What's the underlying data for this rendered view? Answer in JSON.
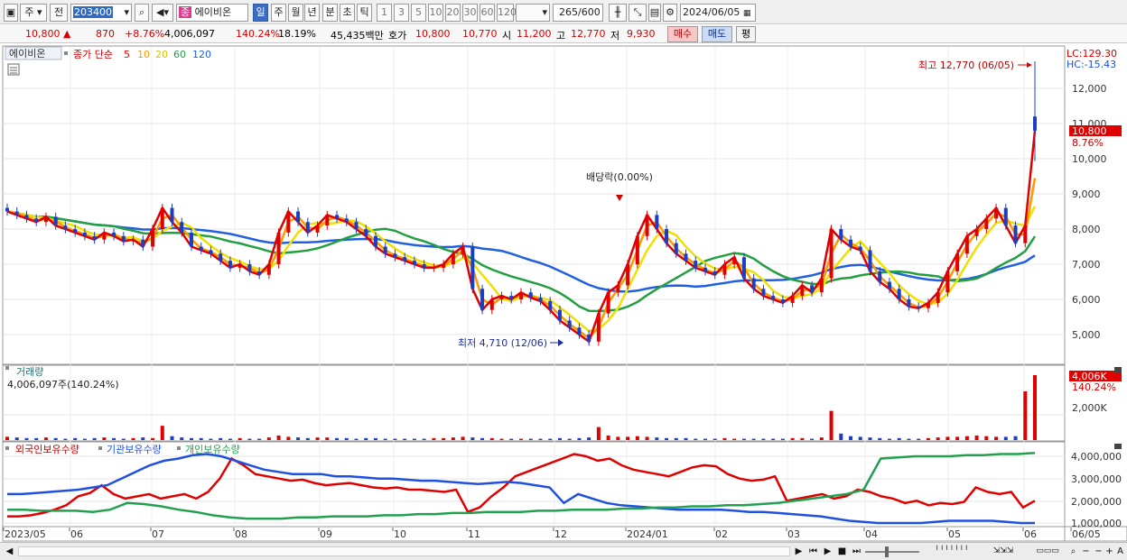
{
  "toolbar": {
    "market": "주",
    "mode": "전",
    "code": "203400",
    "name_badge": "종",
    "name": "에이비온",
    "periods": [
      "일",
      "주",
      "월",
      "년",
      "분",
      "초",
      "틱"
    ],
    "ticks": [
      "1",
      "3",
      "5",
      "10",
      "20",
      "30",
      "60",
      "120"
    ],
    "count": "265",
    "count_total": "/600",
    "date": "2024/06/05"
  },
  "quote": {
    "price": "10,800",
    "change": "870",
    "change_pct": "+8.76%",
    "volume": "4,006,097",
    "volume_ratio": "140.24%",
    "turnover": "18.19%",
    "amount": "45,435백만",
    "bid_label": "호가",
    "ask_price": "10,800",
    "bid_price": "10,770",
    "open_label": "시",
    "open": "11,200",
    "high_label": "고",
    "high": "12,770",
    "low_label": "저",
    "low": "9,930",
    "buy_button": "매수",
    "sell_button": "매도",
    "eval_button": "평"
  },
  "price_panel": {
    "name": "에이비온",
    "ma_label": "종가 단순",
    "ma_periods": [
      "5",
      "10",
      "20",
      "60",
      "120"
    ],
    "ma_colors": [
      "#e00000",
      "#ff9900",
      "#f0e000",
      "#22a040",
      "#2060e0"
    ],
    "lc_label": "LC:129.30",
    "hc_label": "HC:-15.43",
    "y_ticks": [
      "12,000",
      "11,000",
      "10,000",
      "9,000",
      "8,000",
      "7,000",
      "6,000",
      "5,000"
    ],
    "current_price_tag": "10,800",
    "current_pct_tag": "8.76%",
    "high_note": "최고 12,770 (06/05)",
    "low_note": "최저 4,710 (12/06)",
    "dividend_note": "배당락(0.00%)"
  },
  "volume_panel": {
    "title": "거래량",
    "value": "4,006,097주(140.24%)",
    "y_tick": "2,000K",
    "tag_value": "4,006K",
    "tag_pct": "140.24%"
  },
  "holding_panel": {
    "series": [
      "외국인보유수량",
      "기관보유수량",
      "개인보유수량"
    ],
    "series_colors": [
      "#e00000",
      "#2050e0",
      "#22a050"
    ],
    "y_ticks": [
      "4,000,000",
      "3,000,000",
      "2,000,000",
      "1,000,000"
    ]
  },
  "x_axis": {
    "labels": [
      "2023/05",
      "06",
      "07",
      "08",
      "09",
      "10",
      "11",
      "12",
      "2024/01",
      "02",
      "03",
      "04",
      "05",
      "06",
      "06/05"
    ]
  },
  "chart_data": {
    "type": "candlestick",
    "y_range": [
      4500,
      13000
    ],
    "closes": [
      8500,
      8400,
      8300,
      8200,
      8350,
      8100,
      8000,
      7900,
      7800,
      7700,
      7900,
      7800,
      7650,
      7700,
      7500,
      8000,
      8600,
      8200,
      7900,
      7500,
      7400,
      7300,
      7100,
      6900,
      7000,
      6800,
      6700,
      7000,
      7900,
      8500,
      8200,
      7900,
      8100,
      8400,
      8300,
      8200,
      8000,
      7800,
      7500,
      7300,
      7200,
      7100,
      7000,
      6900,
      6900,
      7000,
      7300,
      7500,
      6300,
      5700,
      6000,
      6100,
      6000,
      6200,
      6050,
      5950,
      5700,
      5400,
      5200,
      5000,
      4800,
      5600,
      6200,
      6400,
      7000,
      7800,
      8400,
      8000,
      7600,
      7300,
      7100,
      6900,
      6800,
      6700,
      7000,
      7200,
      6600,
      6300,
      6100,
      6000,
      5900,
      6100,
      6400,
      6200,
      6600,
      8000,
      7700,
      7500,
      7400,
      6800,
      6500,
      6300,
      6000,
      5800,
      5750,
      5900,
      6200,
      6800,
      7300,
      7800,
      8000,
      8300,
      8600,
      8100,
      7600,
      8100,
      10800
    ],
    "volume_levels": [
      0.05,
      0.04,
      0.03,
      0.03,
      0.04,
      0.03,
      0.02,
      0.03,
      0.02,
      0.03,
      0.04,
      0.03,
      0.02,
      0.03,
      0.04,
      0.03,
      0.22,
      0.06,
      0.04,
      0.03,
      0.03,
      0.02,
      0.03,
      0.02,
      0.03,
      0.02,
      0.02,
      0.04,
      0.07,
      0.05,
      0.04,
      0.03,
      0.04,
      0.04,
      0.03,
      0.03,
      0.02,
      0.03,
      0.03,
      0.02,
      0.02,
      0.02,
      0.02,
      0.02,
      0.03,
      0.03,
      0.04,
      0.05,
      0.04,
      0.03,
      0.03,
      0.02,
      0.02,
      0.02,
      0.02,
      0.02,
      0.02,
      0.03,
      0.02,
      0.03,
      0.04,
      0.2,
      0.07,
      0.05,
      0.05,
      0.06,
      0.05,
      0.04,
      0.03,
      0.03,
      0.03,
      0.02,
      0.02,
      0.02,
      0.03,
      0.02,
      0.02,
      0.02,
      0.02,
      0.02,
      0.02,
      0.03,
      0.03,
      0.02,
      0.04,
      0.45,
      0.1,
      0.06,
      0.05,
      0.04,
      0.03,
      0.02,
      0.03,
      0.02,
      0.02,
      0.03,
      0.04,
      0.05,
      0.05,
      0.06,
      0.07,
      0.06,
      0.05,
      0.05,
      0.06,
      0.75,
      1.0
    ],
    "holding": {
      "foreign": [
        1.3,
        1.3,
        1.35,
        1.45,
        1.6,
        1.8,
        2.2,
        2.35,
        2.7,
        2.3,
        2.1,
        2.2,
        2.3,
        2.1,
        2.2,
        2.3,
        2.1,
        2.4,
        3.0,
        3.9,
        3.6,
        3.2,
        3.1,
        3.0,
        2.9,
        2.95,
        2.8,
        2.7,
        2.75,
        2.8,
        2.7,
        2.6,
        2.55,
        2.6,
        2.5,
        2.5,
        2.45,
        2.4,
        2.5,
        1.5,
        1.7,
        2.2,
        2.6,
        3.1,
        3.3,
        3.5,
        3.7,
        3.9,
        4.1,
        4.0,
        3.8,
        3.9,
        3.6,
        3.4,
        3.3,
        3.2,
        3.1,
        3.3,
        3.5,
        3.6,
        3.55,
        3.2,
        3.0,
        2.9,
        2.95,
        3.1,
        2.0,
        2.1,
        2.2,
        2.3,
        2.1,
        2.2,
        2.5,
        2.4,
        2.2,
        2.1,
        1.9,
        2.0,
        1.8,
        1.9,
        1.85,
        1.95,
        2.6,
        2.4,
        2.3,
        2.4,
        1.7,
        2.0
      ],
      "institution": [
        2.3,
        2.3,
        2.35,
        2.4,
        2.45,
        2.5,
        2.6,
        2.7,
        3.0,
        3.3,
        3.6,
        3.8,
        3.9,
        4.05,
        4.1,
        4.0,
        3.8,
        3.6,
        3.4,
        3.3,
        3.2,
        3.2,
        3.2,
        3.1,
        3.1,
        3.05,
        3.0,
        3.0,
        2.95,
        2.9,
        2.9,
        2.85,
        2.8,
        2.75,
        2.8,
        2.85,
        2.8,
        2.7,
        2.6,
        1.9,
        2.3,
        2.1,
        1.9,
        1.8,
        1.75,
        1.7,
        1.65,
        1.6,
        1.6,
        1.6,
        1.6,
        1.55,
        1.5,
        1.5,
        1.45,
        1.4,
        1.35,
        1.3,
        1.2,
        1.1,
        1.05,
        1.0,
        1.0,
        1.0,
        1.0,
        1.05,
        1.1,
        1.1,
        1.1,
        1.1,
        1.05,
        1.0,
        1.0
      ],
      "individual": [
        1.6,
        1.6,
        1.55,
        1.55,
        1.55,
        1.5,
        1.6,
        1.9,
        1.85,
        1.75,
        1.6,
        1.5,
        1.35,
        1.25,
        1.2,
        1.2,
        1.2,
        1.25,
        1.25,
        1.3,
        1.3,
        1.3,
        1.35,
        1.35,
        1.4,
        1.4,
        1.45,
        1.45,
        1.5,
        1.5,
        1.5,
        1.55,
        1.55,
        1.6,
        1.6,
        1.6,
        1.65,
        1.65,
        1.7,
        1.7,
        1.75,
        1.75,
        1.8,
        1.8,
        1.85,
        1.9,
        2.0,
        2.1,
        2.2,
        2.3,
        2.5,
        3.9,
        3.95,
        4.0,
        4.0,
        4.0,
        4.05,
        4.05,
        4.1,
        4.1,
        4.15
      ]
    }
  }
}
